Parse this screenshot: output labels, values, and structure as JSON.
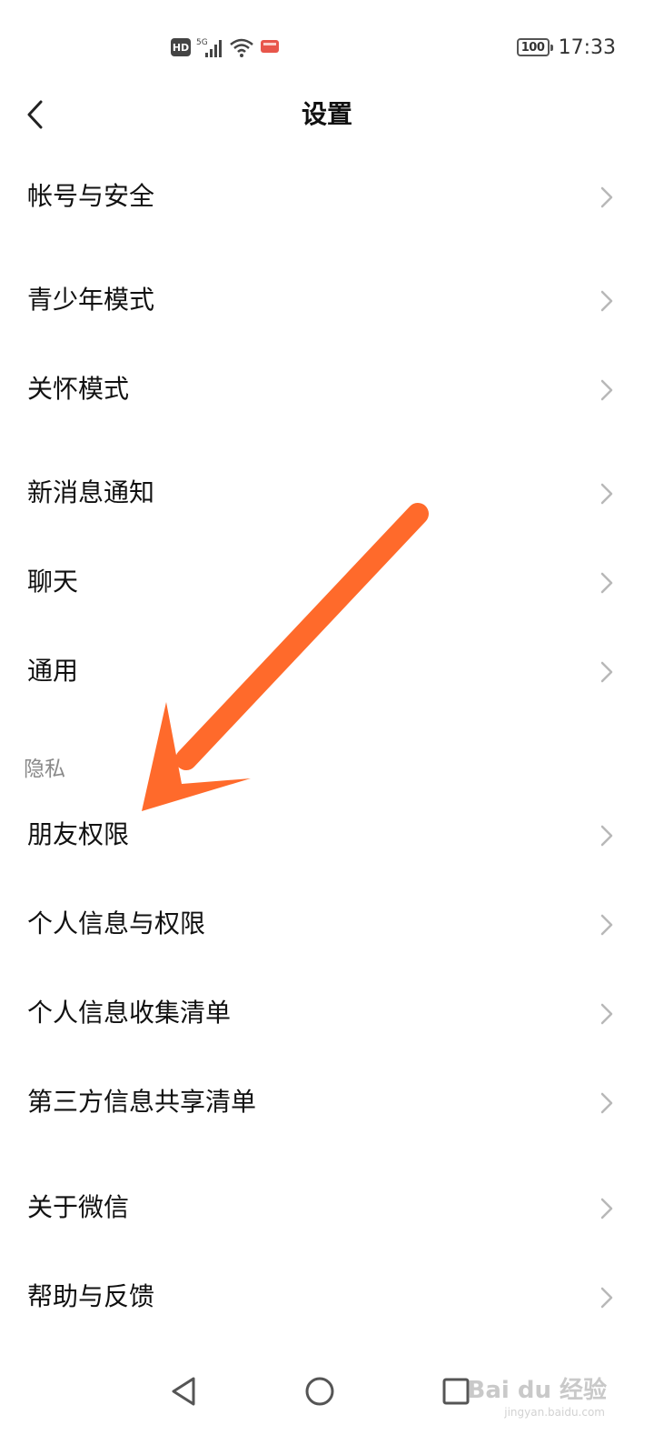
{
  "status_bar": {
    "hd_label": "HD",
    "network_label": "5G",
    "battery_level": "100",
    "time": "17:33"
  },
  "header": {
    "title": "设置"
  },
  "settings": {
    "items": [
      {
        "label": "帐号与安全"
      },
      {
        "label": "青少年模式"
      },
      {
        "label": "关怀模式"
      },
      {
        "label": "新消息通知"
      },
      {
        "label": "聊天"
      },
      {
        "label": "通用"
      },
      {
        "label": "朋友权限"
      },
      {
        "label": "个人信息与权限"
      },
      {
        "label": "个人信息收集清单"
      },
      {
        "label": "第三方信息共享清单"
      },
      {
        "label": "关于微信"
      },
      {
        "label": "帮助与反馈"
      }
    ],
    "privacy_section_label": "隐私"
  },
  "watermark": {
    "text": "Bai du 经验",
    "subtext": "jingyan.baidu.com"
  },
  "colors": {
    "arrow": "#ff6a2b",
    "chevron": "#b8b8b8",
    "section_header": "#8a8a8a"
  },
  "icons": {
    "back": "chevron-left-icon",
    "row_chevron": "chevron-right-icon",
    "nav_back": "triangle-back-icon",
    "nav_home": "circle-home-icon",
    "nav_recents": "square-recents-icon"
  }
}
